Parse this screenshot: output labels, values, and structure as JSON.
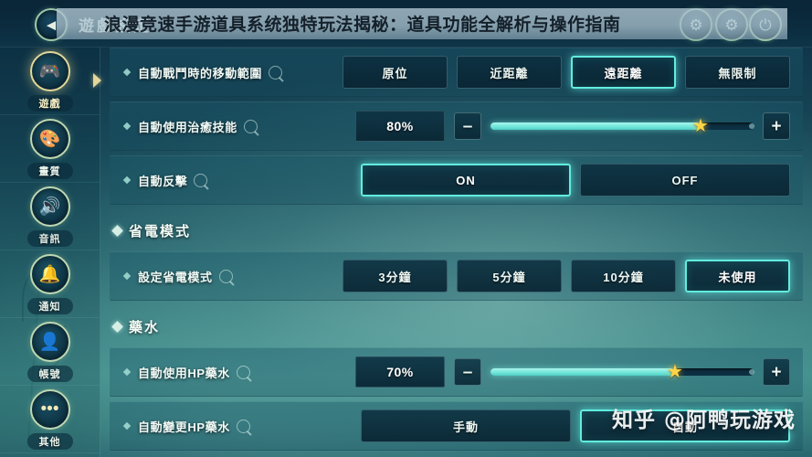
{
  "window": {
    "panel_title": "遊戲設定",
    "overlay_headline": "浪漫竞速手游道具系统独特玩法揭秘：道具功能全解析与操作指南",
    "watermark": "知乎 @阿鸭玩游戏",
    "accent_color": "#62ecdf",
    "knob_color": "#ffd447",
    "background_top": "#0c2d42",
    "background_mid": "#3d8b89"
  },
  "topbar": {
    "back_icon": "◄",
    "gear_icon_1": "⚙",
    "gear_icon_2": "⚙",
    "exit_icon": "⏻"
  },
  "sidebar": {
    "items": [
      {
        "label": "遊戲",
        "icon": "gamepad-icon",
        "glyph": "🎮",
        "active": true
      },
      {
        "label": "畫質",
        "icon": "palette-icon",
        "glyph": "🎨",
        "active": false
      },
      {
        "label": "音訊",
        "icon": "speaker-icon",
        "glyph": "🔊",
        "active": false
      },
      {
        "label": "通知",
        "icon": "bell-icon",
        "glyph": "🔔",
        "active": false
      },
      {
        "label": "帳號",
        "icon": "user-icon",
        "glyph": "👤",
        "active": false
      },
      {
        "label": "其他",
        "icon": "ellipsis-icon",
        "glyph": "•••",
        "active": false
      }
    ]
  },
  "content": {
    "sections": [
      {
        "title": null,
        "rows": [
          {
            "label": "自動戰鬥時的移動範圍",
            "type": "options",
            "options": [
              {
                "label": "原位",
                "selected": false
              },
              {
                "label": "近距離",
                "selected": false
              },
              {
                "label": "遠距離",
                "selected": true
              },
              {
                "label": "無限制",
                "selected": false
              }
            ]
          },
          {
            "label": "自動使用治癒技能",
            "type": "slider",
            "value": "80%",
            "percent": 80,
            "minus": "–",
            "plus": "+"
          },
          {
            "label": "自動反擊",
            "type": "options-wide",
            "options": [
              {
                "label": "ON",
                "selected": true
              },
              {
                "label": "OFF",
                "selected": false
              }
            ]
          }
        ]
      },
      {
        "title": "省電模式",
        "rows": [
          {
            "label": "設定省電模式",
            "type": "options",
            "options": [
              {
                "label": "3分鐘",
                "selected": false
              },
              {
                "label": "5分鐘",
                "selected": false
              },
              {
                "label": "10分鐘",
                "selected": false
              },
              {
                "label": "未使用",
                "selected": true
              }
            ]
          }
        ]
      },
      {
        "title": "藥水",
        "rows": [
          {
            "label": "自動使用HP藥水",
            "type": "slider",
            "value": "70%",
            "percent": 70,
            "minus": "–",
            "plus": "+"
          },
          {
            "label": "自動變更HP藥水",
            "type": "options-wide",
            "options": [
              {
                "label": "手動",
                "selected": false
              },
              {
                "label": "自動",
                "selected": true
              }
            ]
          }
        ]
      }
    ]
  }
}
